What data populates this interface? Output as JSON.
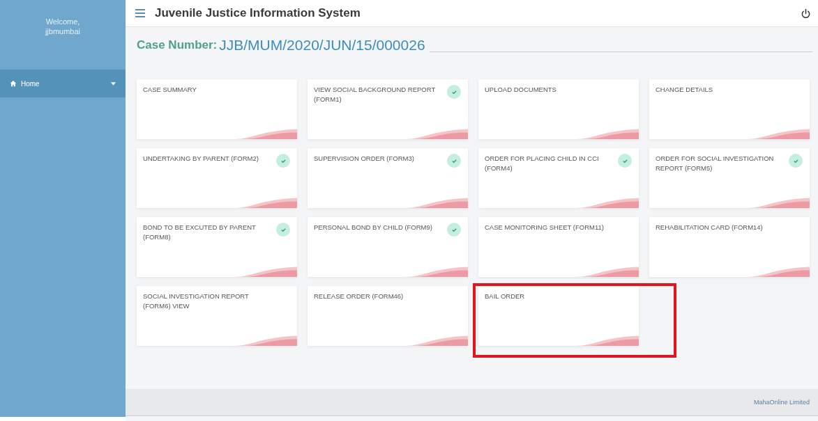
{
  "sidebar": {
    "welcome": "Welcome,",
    "user": "jjbmumbai",
    "items": [
      {
        "label": "Home",
        "selected": true
      }
    ]
  },
  "header": {
    "title": "Juvenile Justice Information System"
  },
  "case": {
    "label": "Case Number:",
    "value": "JJB/MUM/2020/JUN/15/000026"
  },
  "cards": [
    {
      "title": "CASE SUMMARY",
      "checked": false,
      "highlighted": false
    },
    {
      "title": "VIEW SOCIAL BACKGROUND REPORT (FORM1)",
      "checked": true,
      "highlighted": false
    },
    {
      "title": "UPLOAD DOCUMENTS",
      "checked": false,
      "highlighted": false
    },
    {
      "title": "CHANGE DETAILS",
      "checked": false,
      "highlighted": false
    },
    {
      "title": "UNDERTAKING BY PARENT (FORM2)",
      "checked": true,
      "highlighted": false
    },
    {
      "title": "SUPERVISION ORDER (FORM3)",
      "checked": true,
      "highlighted": false
    },
    {
      "title": "ORDER FOR PLACING CHILD IN CCI (FORM4)",
      "checked": true,
      "highlighted": false
    },
    {
      "title": "ORDER FOR SOCIAL INVESTIGATION REPORT (FORM5)",
      "checked": true,
      "highlighted": false
    },
    {
      "title": "BOND TO BE EXCUTED BY PARENT (FORM8)",
      "checked": true,
      "highlighted": false
    },
    {
      "title": "PERSONAL BOND BY CHILD (FORM9)",
      "checked": true,
      "highlighted": false
    },
    {
      "title": "CASE MONITORING SHEET (FORM11)",
      "checked": false,
      "highlighted": false
    },
    {
      "title": "REHABILITATION CARD (FORM14)",
      "checked": false,
      "highlighted": false
    },
    {
      "title": "SOCIAL INVESTIGATION REPORT (FORM6) VIEW",
      "checked": false,
      "highlighted": false
    },
    {
      "title": "RELEASE ORDER (FORM46)",
      "checked": false,
      "highlighted": false
    },
    {
      "title": "BAIL ORDER",
      "checked": false,
      "highlighted": true
    }
  ],
  "footer": {
    "text": "MahaOnline Limited"
  }
}
